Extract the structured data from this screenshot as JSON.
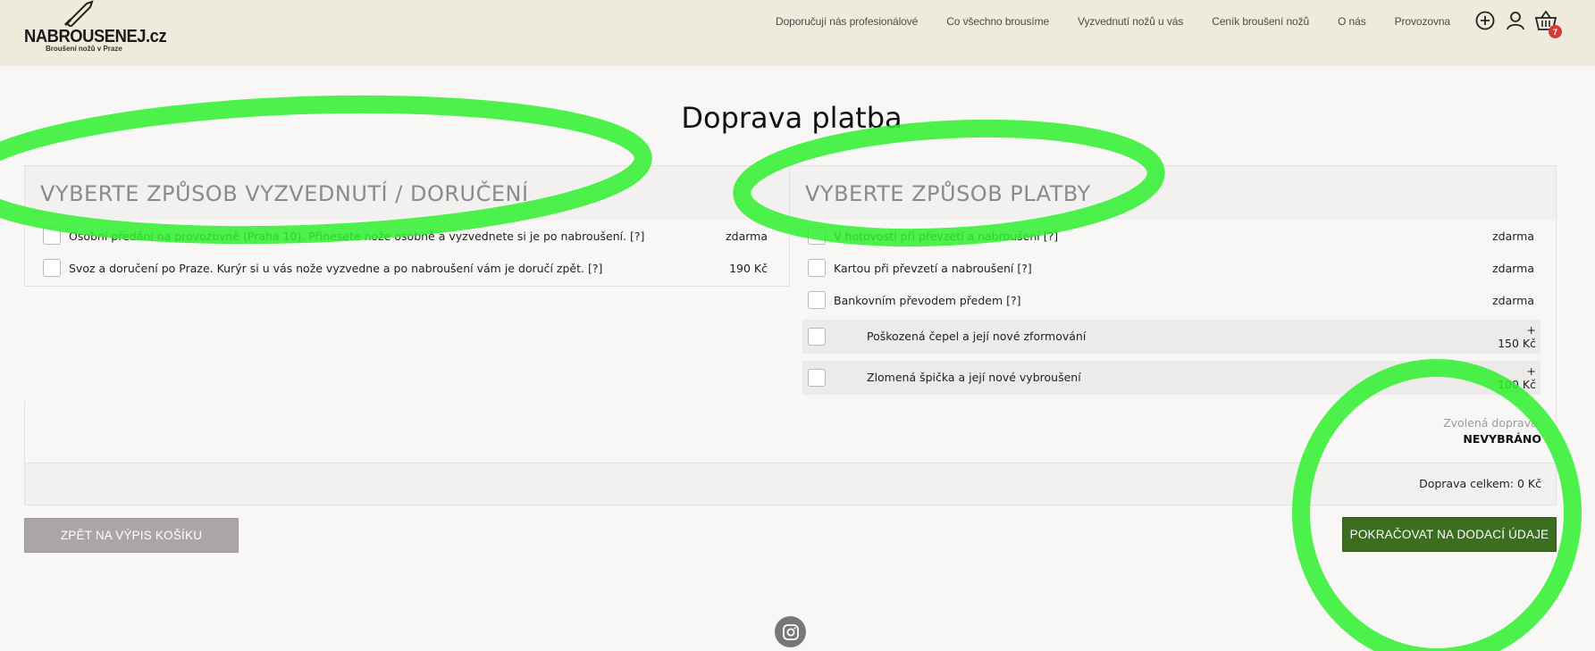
{
  "brand": {
    "name": "NABROUSENEJ.cz",
    "tagline": "Broušení nožů v Praze"
  },
  "nav": {
    "items": [
      "Doporučují nás profesionálové",
      "Co všechno brousíme",
      "Vyzvednutí nožů u vás",
      "Ceník broušení nožů",
      "O nás",
      "Provozovna"
    ]
  },
  "header_icons": {
    "add": "plus-circle-icon",
    "account": "user-icon",
    "cart": "basket-icon",
    "cart_count": "7"
  },
  "page": {
    "title": "Doprava platba"
  },
  "delivery": {
    "heading": "VYBERTE ZPŮSOB VYZVEDNUTÍ / DORUČENÍ",
    "options": [
      {
        "label": "Osobní předání na provozovně (Praha 10). Přinesete nože osobně a vyzvednete si je po nabroušení. [?]",
        "price": "zdarma"
      },
      {
        "label": "Svoz a doručení po Praze. Kurýr si u vás nože vyzvedne a po nabroušení vám je doručí zpět. [?]",
        "price": "190 Kč"
      }
    ]
  },
  "payment": {
    "heading": "VYBERTE ZPŮSOB PLATBY",
    "options": [
      {
        "label": "V hotovosti při převzetí a nabroušení [?]",
        "price": "zdarma"
      },
      {
        "label": "Kartou při převzetí a nabroušení [?]",
        "price": "zdarma"
      },
      {
        "label": "Bankovním převodem předem [?]",
        "price": "zdarma"
      }
    ],
    "extras": [
      {
        "label": "Poškozená čepel a její nové zformování",
        "price_prefix": "+",
        "price": "150 Kč"
      },
      {
        "label": "Zlomená špička a její nové vybroušení",
        "price_prefix": "+",
        "price": "100 Kč"
      }
    ]
  },
  "summary": {
    "chosen_label": "Zvolená doprava:",
    "chosen_value": "NEVYBRÁNO",
    "total": "Doprava celkem: 0 Kč"
  },
  "buttons": {
    "back": "ZPĚT NA VÝPIS KOŠÍKU",
    "continue": "POKRAČOVAT NA DODACÍ ÚDAJE"
  },
  "footer": {
    "social": "instagram-icon"
  },
  "colors": {
    "header_bg": "#efebdc",
    "accent_green": "#3b6e1f",
    "back_button": "#aaa6a5",
    "badge": "#d63b3b",
    "highlight": "#2ef02e"
  }
}
